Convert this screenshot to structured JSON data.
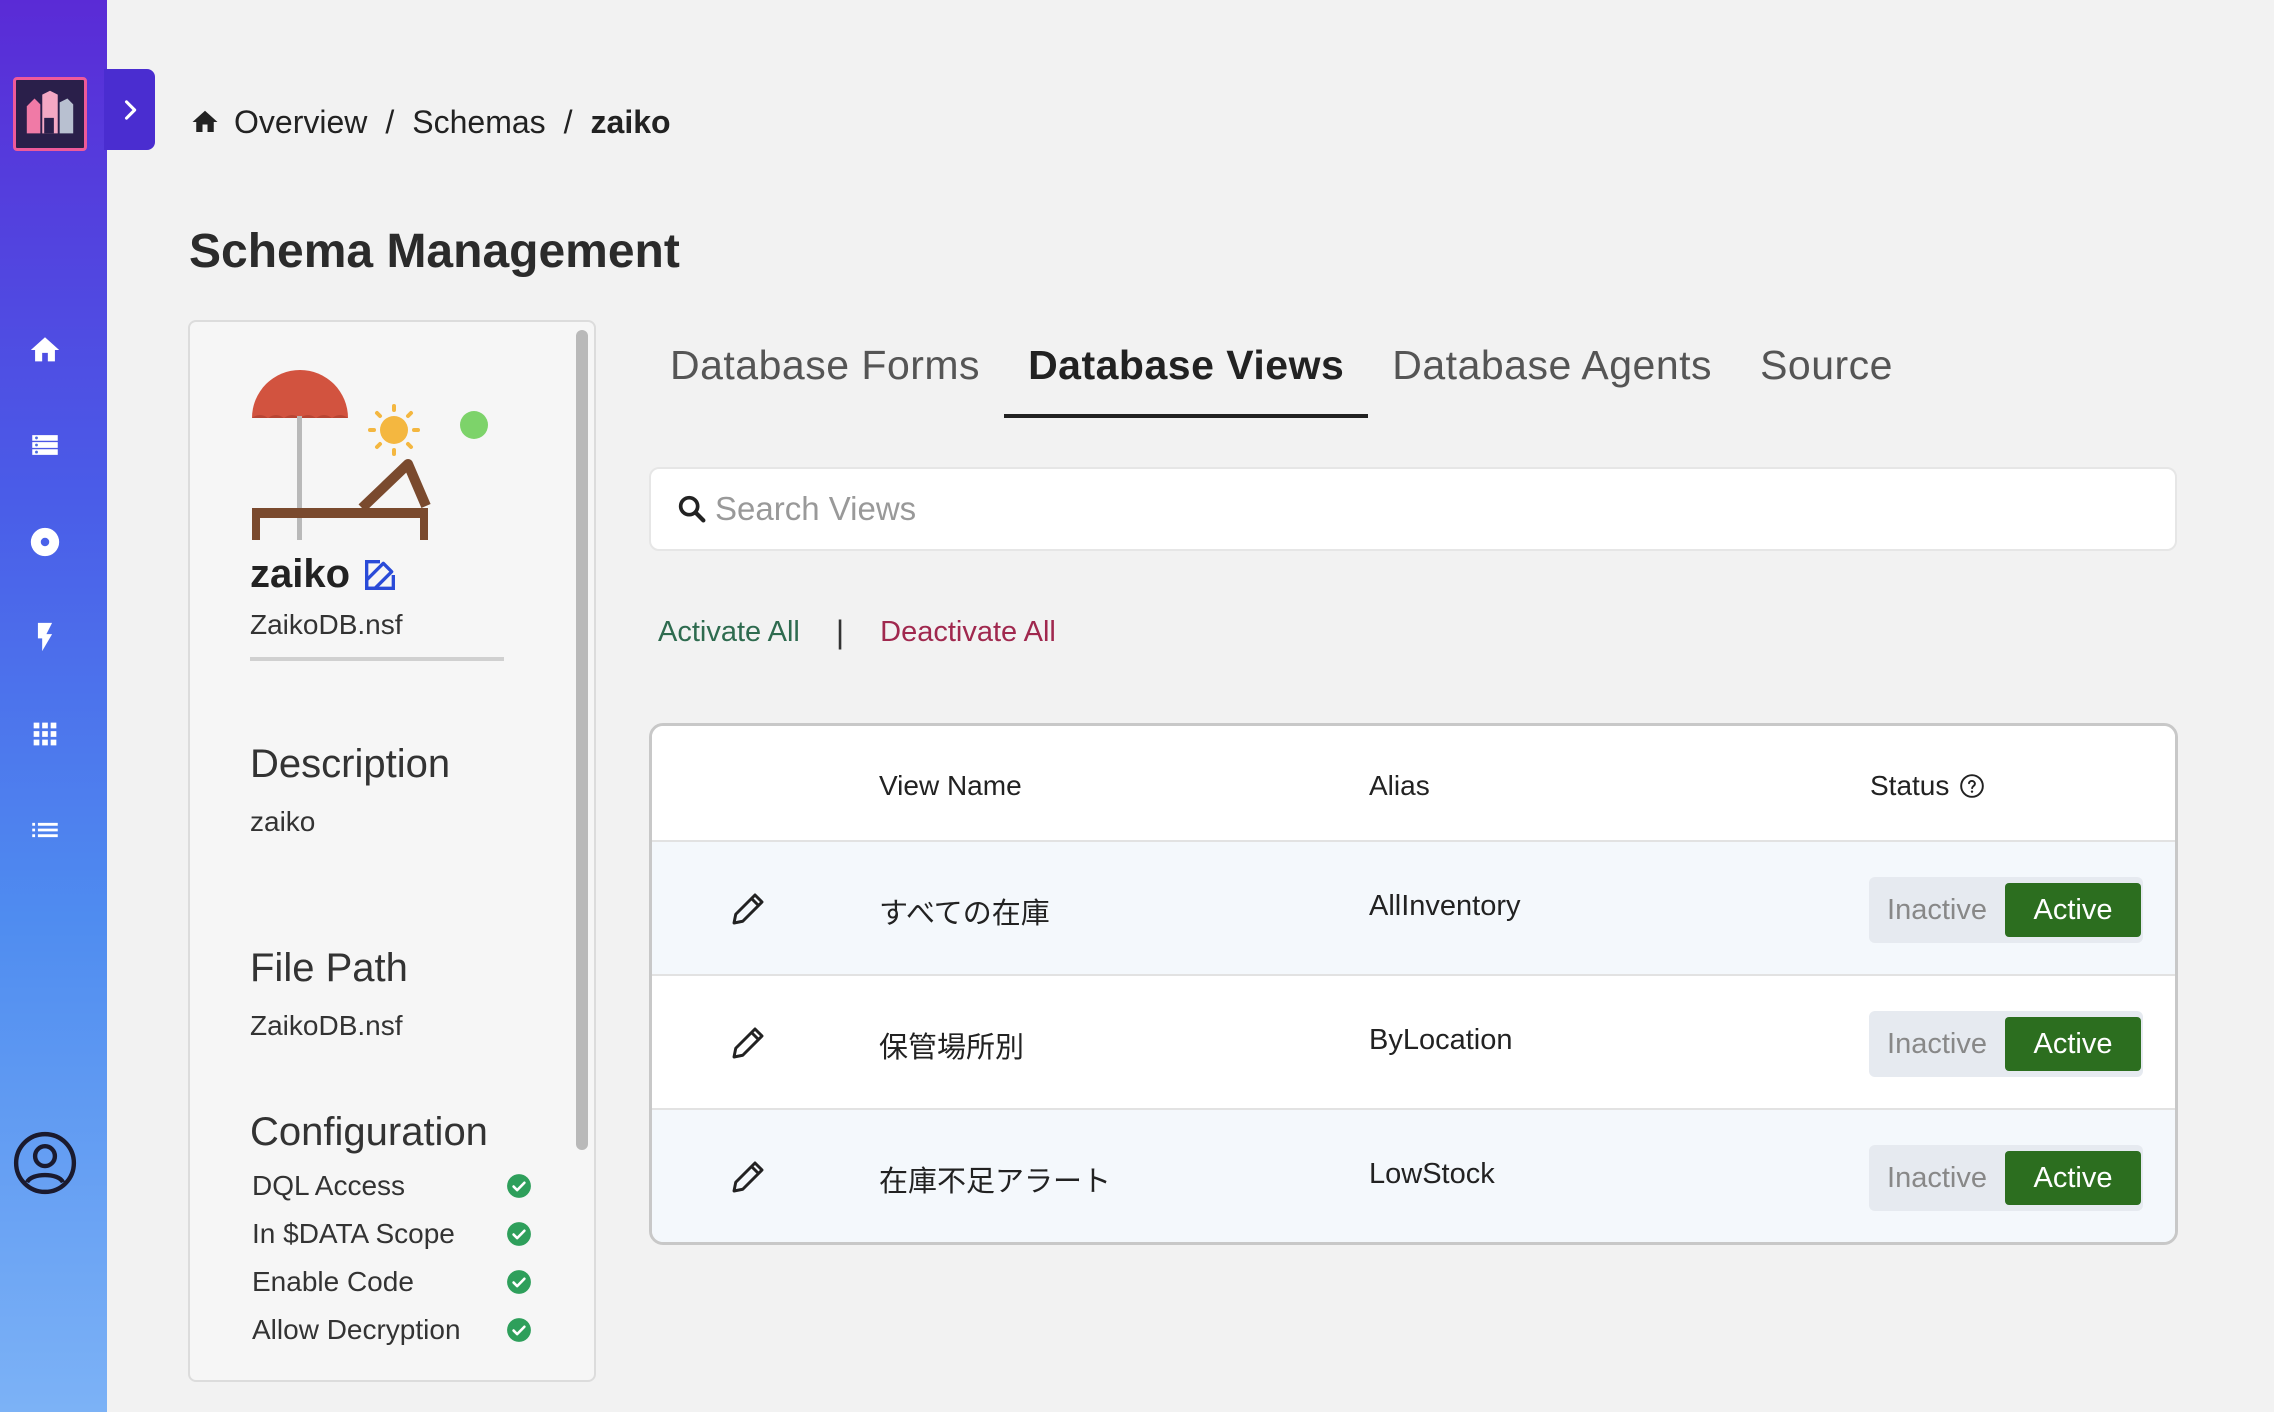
{
  "breadcrumb": {
    "items": [
      "Overview",
      "Schemas"
    ],
    "separator": "/",
    "current": "zaiko"
  },
  "page": {
    "title": "Schema Management"
  },
  "schema": {
    "name": "zaiko",
    "file": "ZaikoDB.nsf",
    "description_heading": "Description",
    "description": "zaiko",
    "filepath_heading": "File Path",
    "filepath": "ZaikoDB.nsf",
    "configuration_heading": "Configuration",
    "configuration": [
      {
        "label": "DQL Access",
        "enabled": true
      },
      {
        "label": "In $DATA Scope",
        "enabled": true
      },
      {
        "label": "Enable Code",
        "enabled": true
      },
      {
        "label": "Allow Decryption",
        "enabled": true
      }
    ],
    "status_color": "#7dd36a"
  },
  "tabs": [
    {
      "label": "Database Forms",
      "active": false
    },
    {
      "label": "Database Views",
      "active": true
    },
    {
      "label": "Database Agents",
      "active": false
    },
    {
      "label": "Source",
      "active": false
    }
  ],
  "search": {
    "placeholder": "Search Views",
    "value": ""
  },
  "actions": {
    "activate_all": "Activate All",
    "separator": "|",
    "deactivate_all": "Deactivate All"
  },
  "table": {
    "columns": {
      "view_name": "View Name",
      "alias": "Alias",
      "status": "Status"
    },
    "rows": [
      {
        "view_name": "すべての在庫",
        "alias": "AllInventory",
        "inactive_label": "Inactive",
        "active_label": "Active",
        "status": "Active"
      },
      {
        "view_name": "保管場所別",
        "alias": "ByLocation",
        "inactive_label": "Inactive",
        "active_label": "Active",
        "status": "Active"
      },
      {
        "view_name": "在庫不足アラート",
        "alias": "LowStock",
        "inactive_label": "Inactive",
        "active_label": "Active",
        "status": "Active"
      }
    ]
  },
  "sidebar": {
    "icons": [
      "home-icon",
      "database-icon",
      "disc-icon",
      "bolt-icon",
      "apps-grid-icon",
      "list-icon",
      "user-account-icon"
    ]
  },
  "colors": {
    "active_green": "#2c6e1f",
    "activate_text": "#2e6b4f",
    "deactivate_text": "#a0284e"
  }
}
